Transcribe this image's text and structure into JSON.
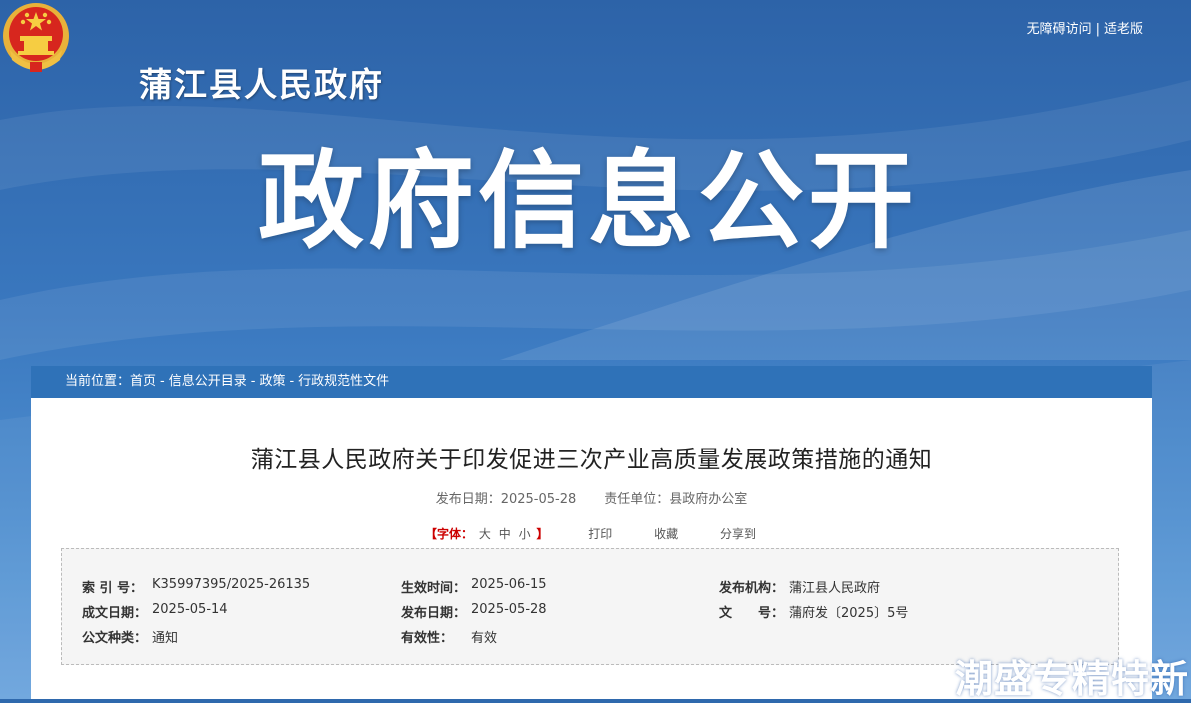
{
  "header": {
    "site_name": "蒲江县人民政府",
    "banner_title": "政府信息公开",
    "links": {
      "accessibility": "无障碍访问",
      "elderly": "适老版",
      "separator": "|"
    }
  },
  "breadcrumb": {
    "prefix": "当前位置：",
    "items": [
      "首页",
      "信息公开目录",
      "政策",
      "行政规范性文件"
    ],
    "separator": "-"
  },
  "document": {
    "title": "蒲江县人民政府关于印发促进三次产业高质量发展政策措施的通知",
    "publish_label": "发布日期：",
    "publish_date": "2025-05-28",
    "dept_label": "责任单位：",
    "dept": "县政府办公室"
  },
  "tools": {
    "font_open": "【字体：",
    "font_large": "大",
    "font_medium": "中",
    "font_small": "小",
    "font_close": "】",
    "print": "打印",
    "favorite": "收藏",
    "share": "分享到"
  },
  "info": {
    "index_label": "索 引 号：",
    "index_value": "K35997395/2025-26135",
    "effective_label": "生效时间：",
    "effective_value": "2025-06-15",
    "issuer_label": "发布机构：",
    "issuer_value": "蒲江县人民政府",
    "created_label": "成文日期：",
    "created_value": "2025-05-14",
    "publish_label": "发布日期：",
    "publish_value": "2025-05-28",
    "docno_label": "文　　号：",
    "docno_value": "蒲府发〔2025〕5号",
    "type_label": "公文种类：",
    "type_value": "通知",
    "validity_label": "有效性：",
    "validity_value": "有效"
  },
  "watermark": "潮盛专精特新",
  "colors": {
    "banner_blue": "#2f69ad",
    "breadcrumb_blue": "#2f72b8",
    "accent_red": "#cc0000"
  }
}
